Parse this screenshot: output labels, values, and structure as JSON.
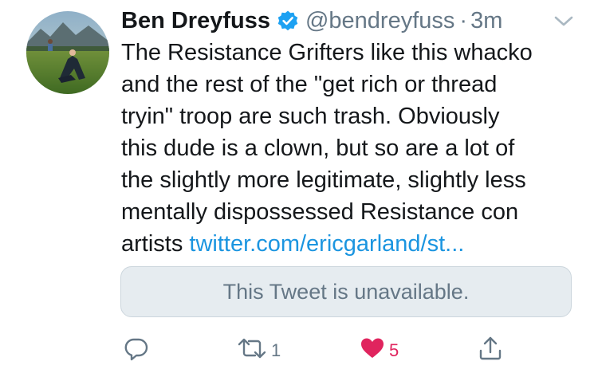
{
  "tweet": {
    "display_name": "Ben Dreyfuss",
    "handle": "@bendreyfuss",
    "separator": "·",
    "time": "3m",
    "text_lines": [
      "The Resistance Grifters like this whacko",
      "and the rest of the \"get rich or thread",
      "tryin\" troop are such trash. Obviously",
      "this dude is a clown, but so are a lot of",
      "the slightly more legitimate, slightly less",
      "mentally dispossessed Resistance con"
    ],
    "last_line_text": "artists ",
    "link_text": "twitter.com/ericgarland/st...",
    "quote_unavailable": "This Tweet is unavailable.",
    "retweet_count": "1",
    "like_count": "5"
  },
  "colors": {
    "link": "#1b95e0",
    "like": "#e0245e",
    "verified": "#1da1f2",
    "muted": "#657786"
  },
  "icons": {
    "verified": "verified-badge-icon",
    "caret": "chevron-down-icon",
    "reply": "reply-icon",
    "retweet": "retweet-icon",
    "like": "heart-icon",
    "share": "share-icon"
  }
}
